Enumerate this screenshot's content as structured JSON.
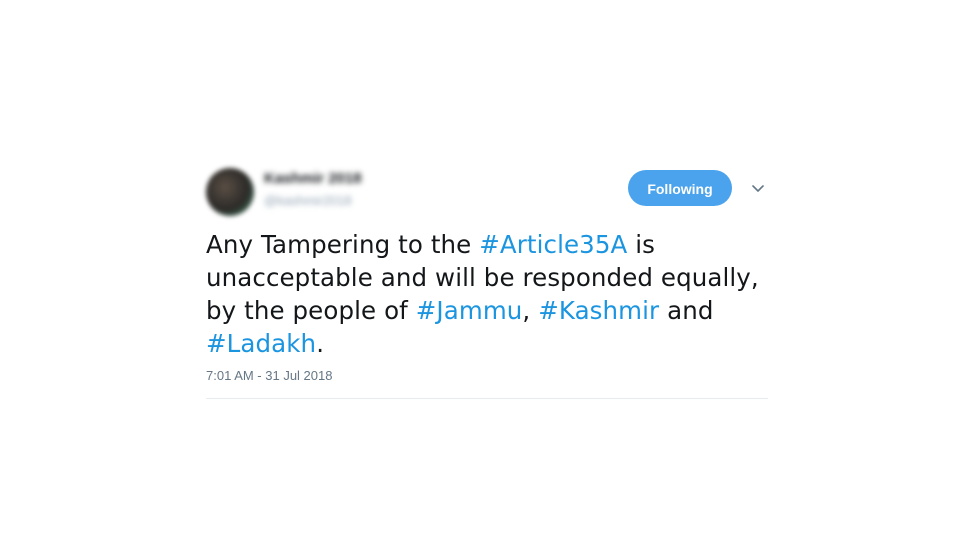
{
  "author": {
    "display_name": "Kashmir 2018",
    "handle": "@kashmir2018"
  },
  "follow_button": {
    "label": "Following"
  },
  "tweet": {
    "text_parts": [
      "Any Tampering to the ",
      "#Article35A",
      " is unacceptable and will be responded equally, by the people of ",
      "#Jammu",
      ", ",
      "#Kashmir",
      " and ",
      "#Ladakh",
      "."
    ],
    "timestamp": "7:01 AM - 31 Jul 2018"
  },
  "icons": {
    "caret": "chevron-down-icon",
    "avatar": "avatar"
  },
  "colors": {
    "button": "#4aa3ec",
    "hashtag": "#1b95e0",
    "text": "#14171a",
    "meta": "#657786"
  }
}
